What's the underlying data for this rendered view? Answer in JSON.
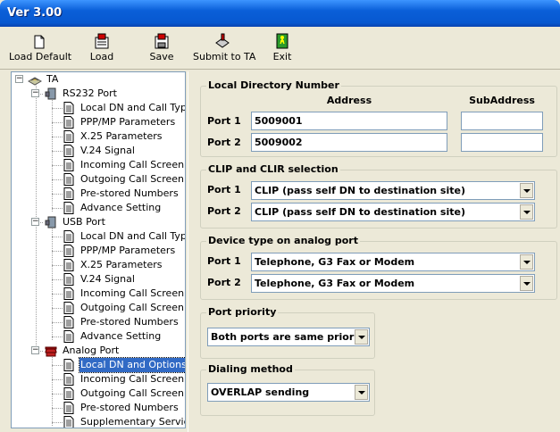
{
  "window": {
    "title": "Ver 3.00"
  },
  "toolbar": {
    "buttons": [
      {
        "label": "Load Default",
        "icon": "document-icon"
      },
      {
        "label": "Load",
        "icon": "load-icon"
      },
      {
        "label": "Save",
        "icon": "save-icon"
      },
      {
        "label": "Submit to TA",
        "icon": "submit-icon"
      },
      {
        "label": "Exit",
        "icon": "exit-icon"
      }
    ]
  },
  "tree": {
    "root": "TA",
    "groups": [
      {
        "label": "RS232 Port",
        "items": [
          "Local DN and Call Type",
          "PPP/MP Parameters",
          "X.25 Parameters",
          "V.24 Signal",
          "Incoming Call Screen",
          "Outgoing Call Screen",
          "Pre-stored Numbers",
          "Advance Setting"
        ]
      },
      {
        "label": "USB Port",
        "items": [
          "Local DN and Call Type",
          "PPP/MP Parameters",
          "X.25 Parameters",
          "V.24 Signal",
          "Incoming Call Screen",
          "Outgoing Call Screen",
          "Pre-stored Numbers",
          "Advance Setting"
        ]
      },
      {
        "label": "Analog Port",
        "items": [
          "Local DN and Options",
          "Incoming Call Screen",
          "Outgoing Call Screen",
          "Pre-stored Numbers",
          "Supplementary Service"
        ]
      }
    ],
    "selected": "Local DN and Options"
  },
  "local_directory": {
    "title": "Local Directory Number",
    "address_header": "Address",
    "subaddress_header": "SubAddress",
    "port1_label": "Port 1",
    "port2_label": "Port 2",
    "port1_address": "5009001",
    "port2_address": "5009002",
    "port1_subaddress": "",
    "port2_subaddress": ""
  },
  "clip": {
    "title": "CLIP and CLIR selection",
    "port1_label": "Port 1",
    "port2_label": "Port 2",
    "port1_value": "CLIP (pass self DN to destination site)",
    "port2_value": "CLIP (pass self DN to destination site)"
  },
  "device_type": {
    "title": "Device type on analog port",
    "port1_label": "Port 1",
    "port2_label": "Port 2",
    "port1_value": "Telephone, G3 Fax or Modem",
    "port2_value": "Telephone, G3 Fax or Modem"
  },
  "priority": {
    "title": "Port priority",
    "value": "Both ports are same priority"
  },
  "dialing": {
    "title": "Dialing method",
    "value": "OVERLAP sending"
  }
}
